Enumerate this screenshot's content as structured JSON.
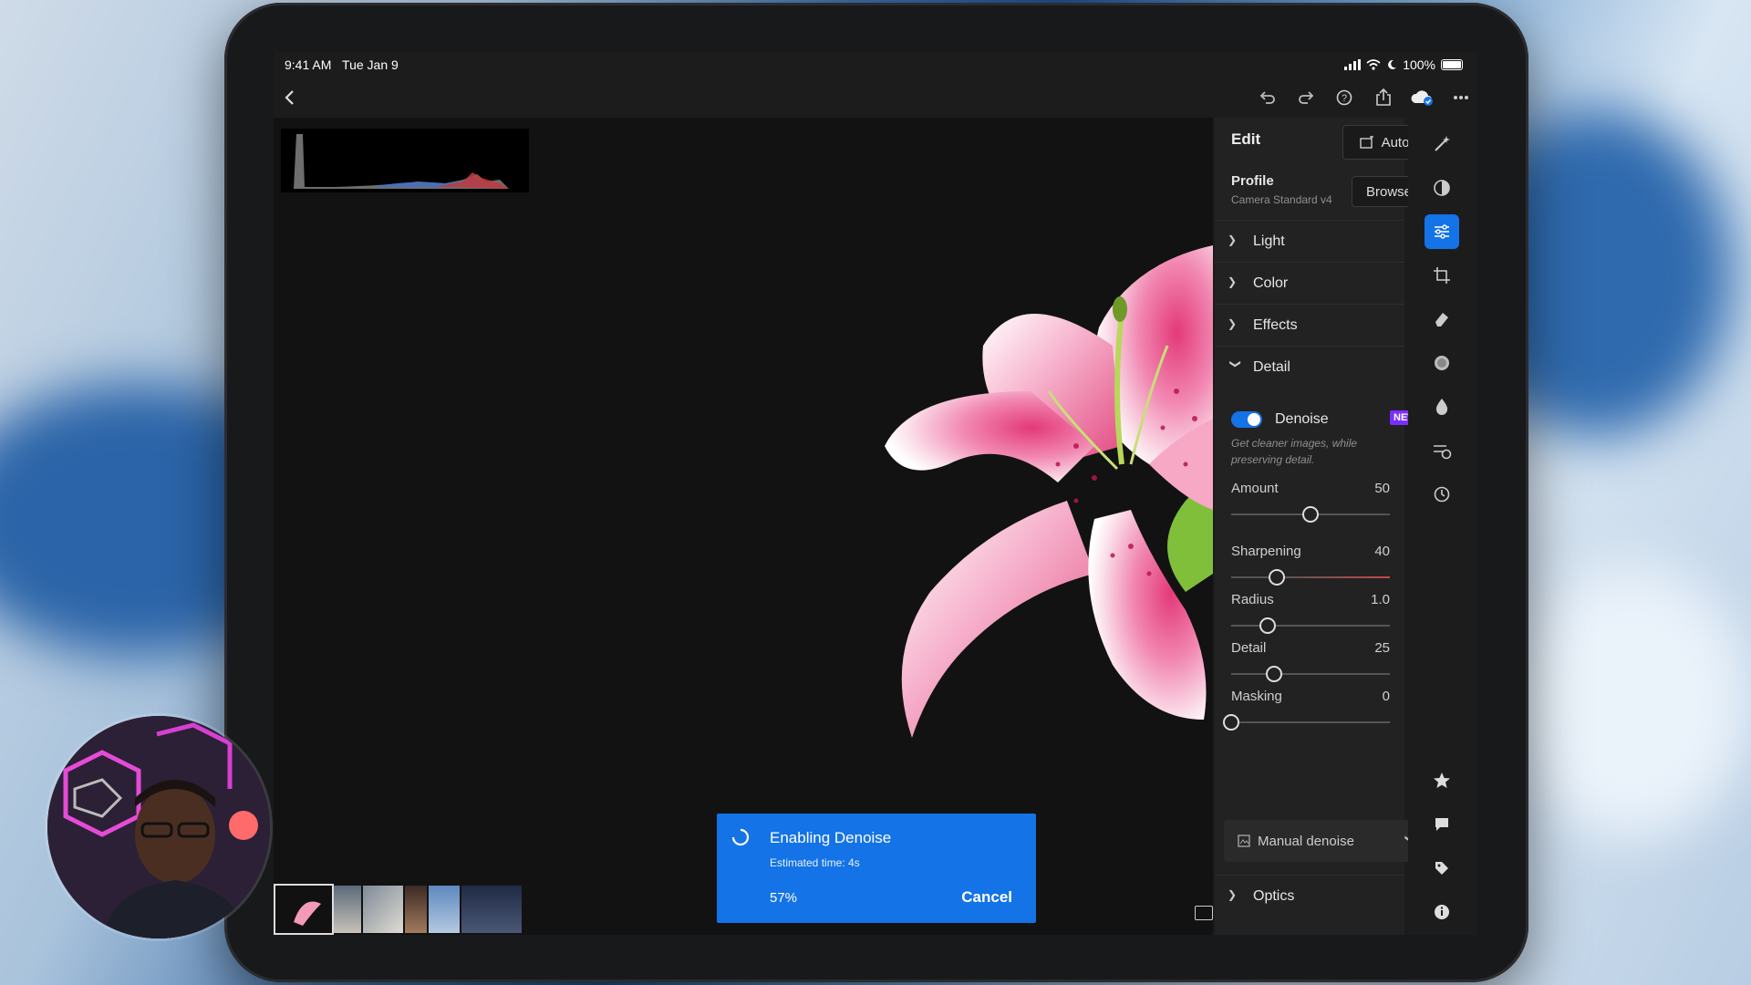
{
  "status_bar": {
    "time": "9:41 AM",
    "date": "Tue Jan 9",
    "battery": "100%",
    "icons": [
      "cellular-signal-icon",
      "wifi-icon",
      "moon-icon",
      "battery-icon"
    ]
  },
  "toolbar": {
    "icons": [
      "back-icon",
      "undo-icon",
      "redo-icon",
      "help-icon",
      "share-icon",
      "cloud-sync-icon",
      "more-icon"
    ]
  },
  "panel": {
    "title": "Edit",
    "auto_label": "Auto",
    "profile_label": "Profile",
    "profile_value": "Camera Standard v4",
    "browse_label": "Browse",
    "sections": {
      "light": "Light",
      "color": "Color",
      "effects": "Effects",
      "detail": "Detail",
      "optics": "Optics"
    },
    "denoise": {
      "label": "Denoise",
      "badge": "NEW",
      "enabled": true,
      "description": "Get cleaner images, while preserving detail."
    },
    "sliders": [
      {
        "label": "Amount",
        "value": "50",
        "fraction": 0.5
      },
      {
        "label": "Sharpening",
        "value": "40",
        "fraction": 0.29
      },
      {
        "label": "Radius",
        "value": "1.0",
        "fraction": 0.23
      },
      {
        "label": "Detail",
        "value": "25",
        "fraction": 0.27
      },
      {
        "label": "Masking",
        "value": "0",
        "fraction": 0.0
      }
    ],
    "manual_denoise_label": "Manual denoise"
  },
  "toast": {
    "title": "Enabling Denoise",
    "subtitle": "Estimated time: 4s",
    "progress": "57%",
    "progress_fraction": 0.57,
    "cancel_label": "Cancel"
  },
  "rail_icons": [
    "auto-magic-icon",
    "presets-icon",
    "adjust-sliders-icon",
    "crop-icon",
    "healing-eraser-icon",
    "masking-icon",
    "blur-drop-icon",
    "versions-icon",
    "history-icon",
    "star-icon",
    "comment-icon",
    "tag-icon",
    "info-icon"
  ],
  "colors": {
    "accent": "#1473e6",
    "new_badge": "#7b2fff",
    "panel_bg": "#222222"
  }
}
